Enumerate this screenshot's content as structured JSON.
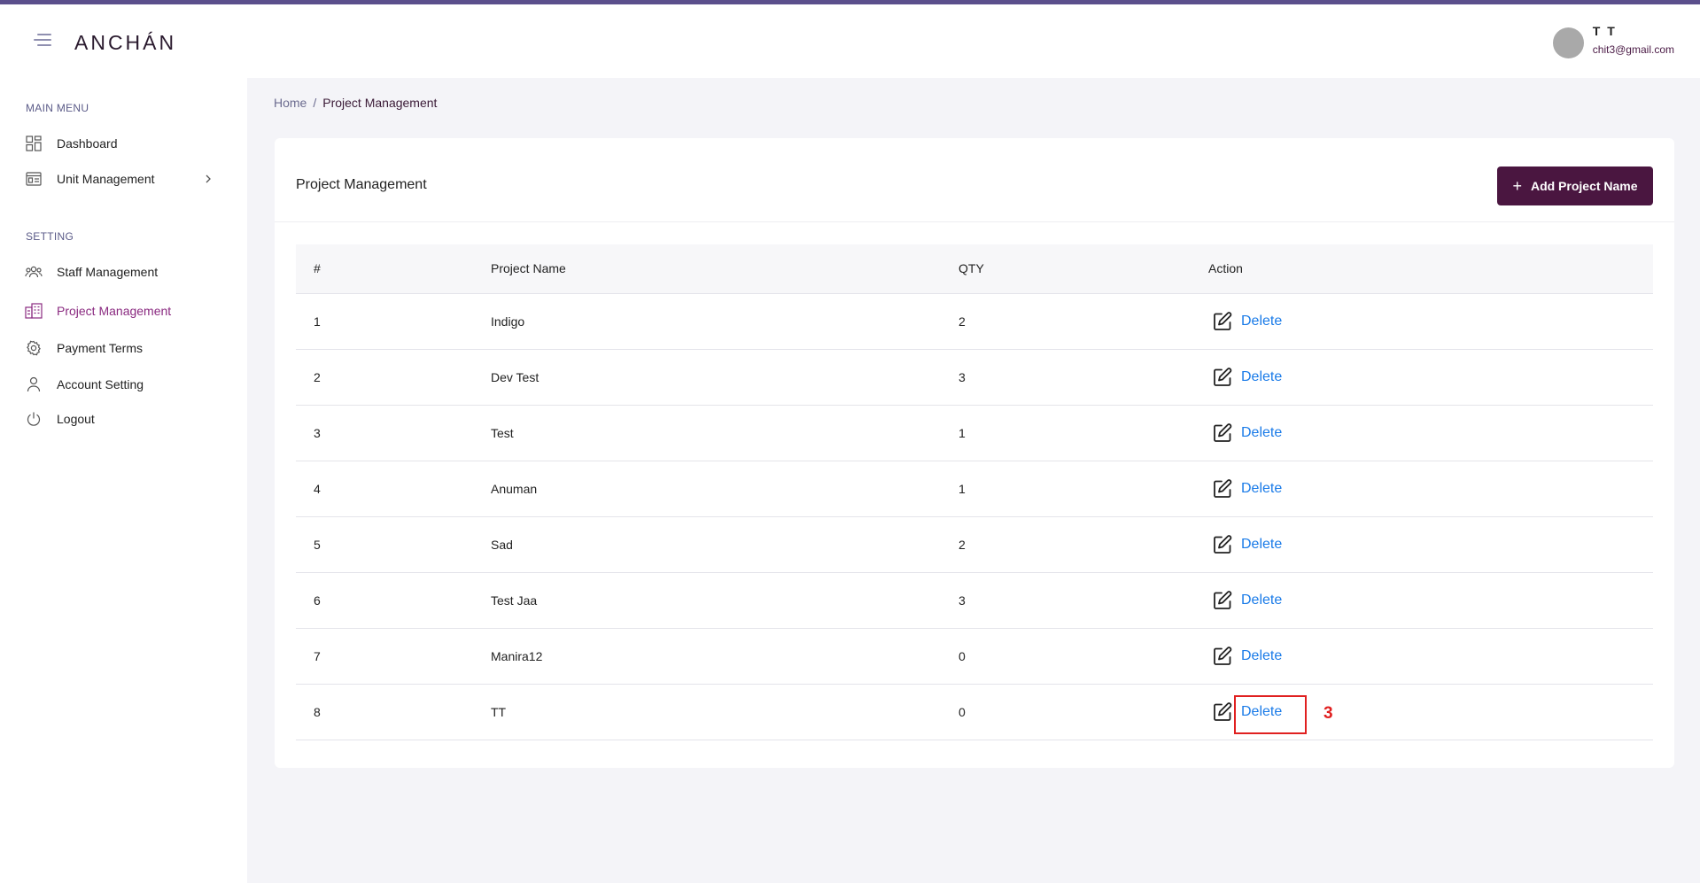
{
  "header": {
    "logo": "ANCHÁN",
    "user": {
      "name": "T T",
      "email": "chit3@gmail.com"
    }
  },
  "sidebar": {
    "main_menu_title": "MAIN MENU",
    "main_items": [
      {
        "label": "Dashboard",
        "icon": "dashboard-icon"
      },
      {
        "label": "Unit Management",
        "icon": "unit-icon"
      }
    ],
    "setting_title": "SETTING",
    "setting_items": [
      {
        "label": "Staff Management",
        "icon": "staff-icon"
      },
      {
        "label": "Project Management",
        "icon": "project-icon"
      },
      {
        "label": "Payment Terms",
        "icon": "gear-icon"
      },
      {
        "label": "Account Setting",
        "icon": "user-icon"
      },
      {
        "label": "Logout",
        "icon": "power-icon"
      }
    ]
  },
  "breadcrumb": {
    "home": "Home",
    "sep": "/",
    "current": "Project Management"
  },
  "card": {
    "title": "Project Management",
    "add_button": "Add Project Name",
    "add_icon": "+"
  },
  "table": {
    "headers": [
      "#",
      "Project Name",
      "QTY",
      "Action"
    ],
    "rows": [
      {
        "num": "1",
        "name": "Indigo",
        "qty": "2",
        "action": "Delete"
      },
      {
        "num": "2",
        "name": "Dev Test",
        "qty": "3",
        "action": "Delete"
      },
      {
        "num": "3",
        "name": "Test",
        "qty": "1",
        "action": "Delete"
      },
      {
        "num": "4",
        "name": "Anuman",
        "qty": "1",
        "action": "Delete"
      },
      {
        "num": "5",
        "name": "Sad",
        "qty": "2",
        "action": "Delete"
      },
      {
        "num": "6",
        "name": "Test Jaa",
        "qty": "3",
        "action": "Delete"
      },
      {
        "num": "7",
        "name": "Manira12",
        "qty": "0",
        "action": "Delete"
      },
      {
        "num": "8",
        "name": "TT",
        "qty": "0",
        "action": "Delete"
      }
    ]
  },
  "annotation": {
    "label": "3",
    "color": "#e02020"
  },
  "colors": {
    "accent": "#4a1640",
    "active_menu": "#8a2a80",
    "link": "#1a7be8",
    "topline": "#5b4f8c"
  }
}
